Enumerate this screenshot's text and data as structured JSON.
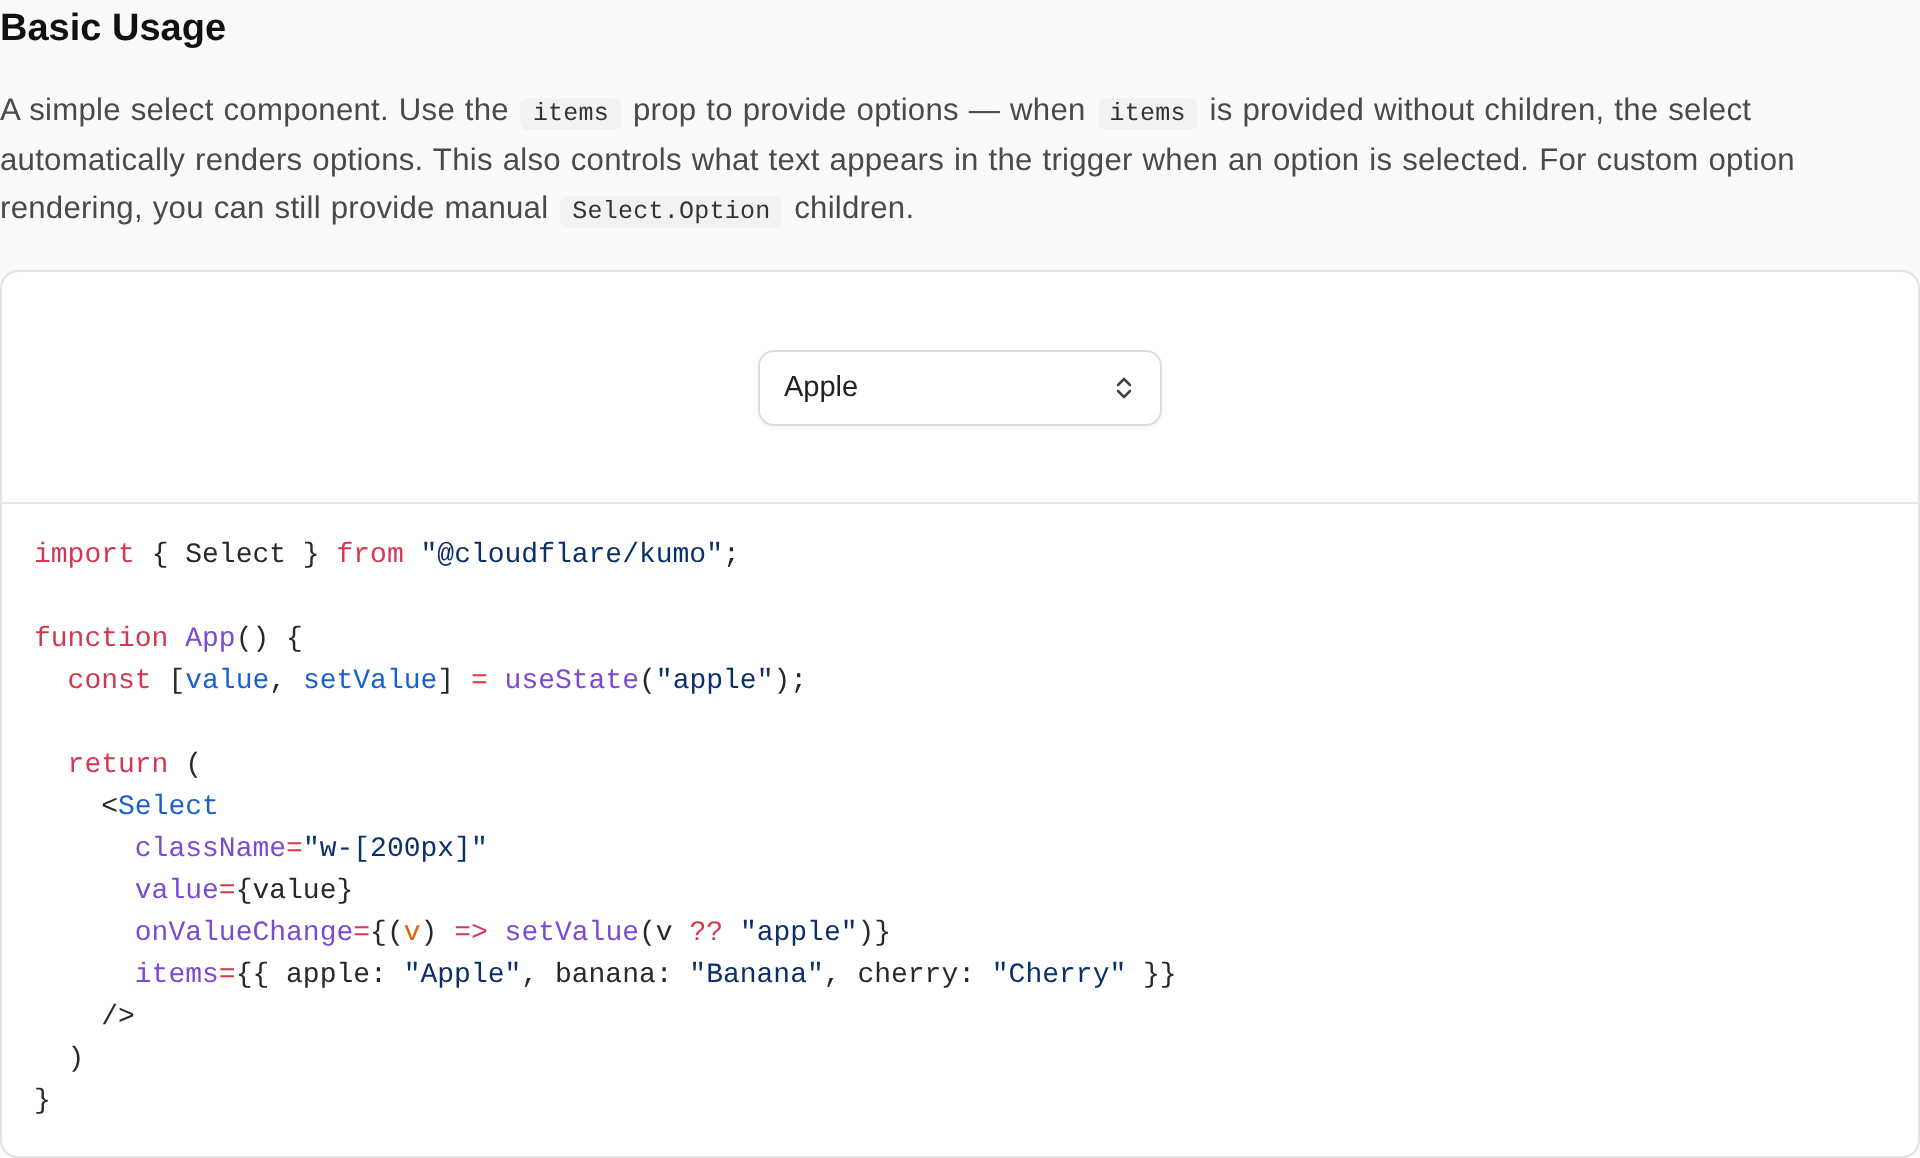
{
  "section": {
    "title": "Basic Usage",
    "description": [
      {
        "kind": "text",
        "text": "A simple select component. Use the "
      },
      {
        "kind": "code",
        "text": "items"
      },
      {
        "kind": "text",
        "text": " prop to provide options — when "
      },
      {
        "kind": "code",
        "text": "items"
      },
      {
        "kind": "text",
        "text": " is provided without children, the select automatically renders options. This also controls what text appears in the trigger when an option is selected. For custom option rendering, you can still provide manual "
      },
      {
        "kind": "code",
        "text": "Select.Option"
      },
      {
        "kind": "text",
        "text": " children."
      }
    ]
  },
  "preview": {
    "select": {
      "value": "Apple"
    }
  },
  "code_lines": [
    {
      "kind": "code",
      "tokens": [
        {
          "kind": "keyword",
          "text": "import"
        },
        {
          "kind": "plain",
          "text": " { Select } "
        },
        {
          "kind": "keyword",
          "text": "from"
        },
        {
          "kind": "string",
          "text": " \"@cloudflare/kumo\""
        },
        {
          "kind": "plain",
          "text": ";"
        }
      ]
    },
    {
      "kind": "blank"
    },
    {
      "kind": "code",
      "tokens": [
        {
          "kind": "keyword",
          "text": "function"
        },
        {
          "kind": "function",
          "text": " App"
        },
        {
          "kind": "plain",
          "text": "() {"
        }
      ]
    },
    {
      "kind": "code",
      "tokens": [
        {
          "kind": "keyword",
          "text": "  const"
        },
        {
          "kind": "plain",
          "text": " ["
        },
        {
          "kind": "variable",
          "text": "value"
        },
        {
          "kind": "plain",
          "text": ", "
        },
        {
          "kind": "variable",
          "text": "setValue"
        },
        {
          "kind": "plain",
          "text": "] "
        },
        {
          "kind": "keyword",
          "text": "="
        },
        {
          "kind": "function",
          "text": " useState"
        },
        {
          "kind": "plain",
          "text": "("
        },
        {
          "kind": "string",
          "text": "\"apple\""
        },
        {
          "kind": "plain",
          "text": ");"
        }
      ]
    },
    {
      "kind": "blank"
    },
    {
      "kind": "code",
      "tokens": [
        {
          "kind": "keyword",
          "text": "  return"
        },
        {
          "kind": "plain",
          "text": " ("
        }
      ]
    },
    {
      "kind": "code",
      "tokens": [
        {
          "kind": "plain",
          "text": "    <"
        },
        {
          "kind": "variable",
          "text": "Select"
        }
      ]
    },
    {
      "kind": "code",
      "tokens": [
        {
          "kind": "function",
          "text": "      className"
        },
        {
          "kind": "keyword",
          "text": "="
        },
        {
          "kind": "string",
          "text": "\"w-[200px]\""
        }
      ]
    },
    {
      "kind": "code",
      "tokens": [
        {
          "kind": "function",
          "text": "      value"
        },
        {
          "kind": "keyword",
          "text": "="
        },
        {
          "kind": "plain",
          "text": "{value}"
        }
      ]
    },
    {
      "kind": "code",
      "tokens": [
        {
          "kind": "function",
          "text": "      onValueChange"
        },
        {
          "kind": "keyword",
          "text": "="
        },
        {
          "kind": "plain",
          "text": "{("
        },
        {
          "kind": "parameter",
          "text": "v"
        },
        {
          "kind": "plain",
          "text": ") "
        },
        {
          "kind": "keyword",
          "text": "=>"
        },
        {
          "kind": "function",
          "text": " setValue"
        },
        {
          "kind": "plain",
          "text": "(v "
        },
        {
          "kind": "keyword",
          "text": "??"
        },
        {
          "kind": "string",
          "text": " \"apple\""
        },
        {
          "kind": "plain",
          "text": ")}"
        }
      ]
    },
    {
      "kind": "code",
      "tokens": [
        {
          "kind": "function",
          "text": "      items"
        },
        {
          "kind": "keyword",
          "text": "="
        },
        {
          "kind": "plain",
          "text": "{{ apple: "
        },
        {
          "kind": "string",
          "text": "\"Apple\""
        },
        {
          "kind": "plain",
          "text": ", banana: "
        },
        {
          "kind": "string",
          "text": "\"Banana\""
        },
        {
          "kind": "plain",
          "text": ", cherry: "
        },
        {
          "kind": "string",
          "text": "\"Cherry\""
        },
        {
          "kind": "plain",
          "text": " }}"
        }
      ]
    },
    {
      "kind": "code",
      "tokens": [
        {
          "kind": "plain",
          "text": "    />"
        }
      ]
    },
    {
      "kind": "code",
      "tokens": [
        {
          "kind": "plain",
          "text": "  )"
        }
      ]
    },
    {
      "kind": "code",
      "tokens": [
        {
          "kind": "plain",
          "text": "}"
        }
      ]
    }
  ]
}
